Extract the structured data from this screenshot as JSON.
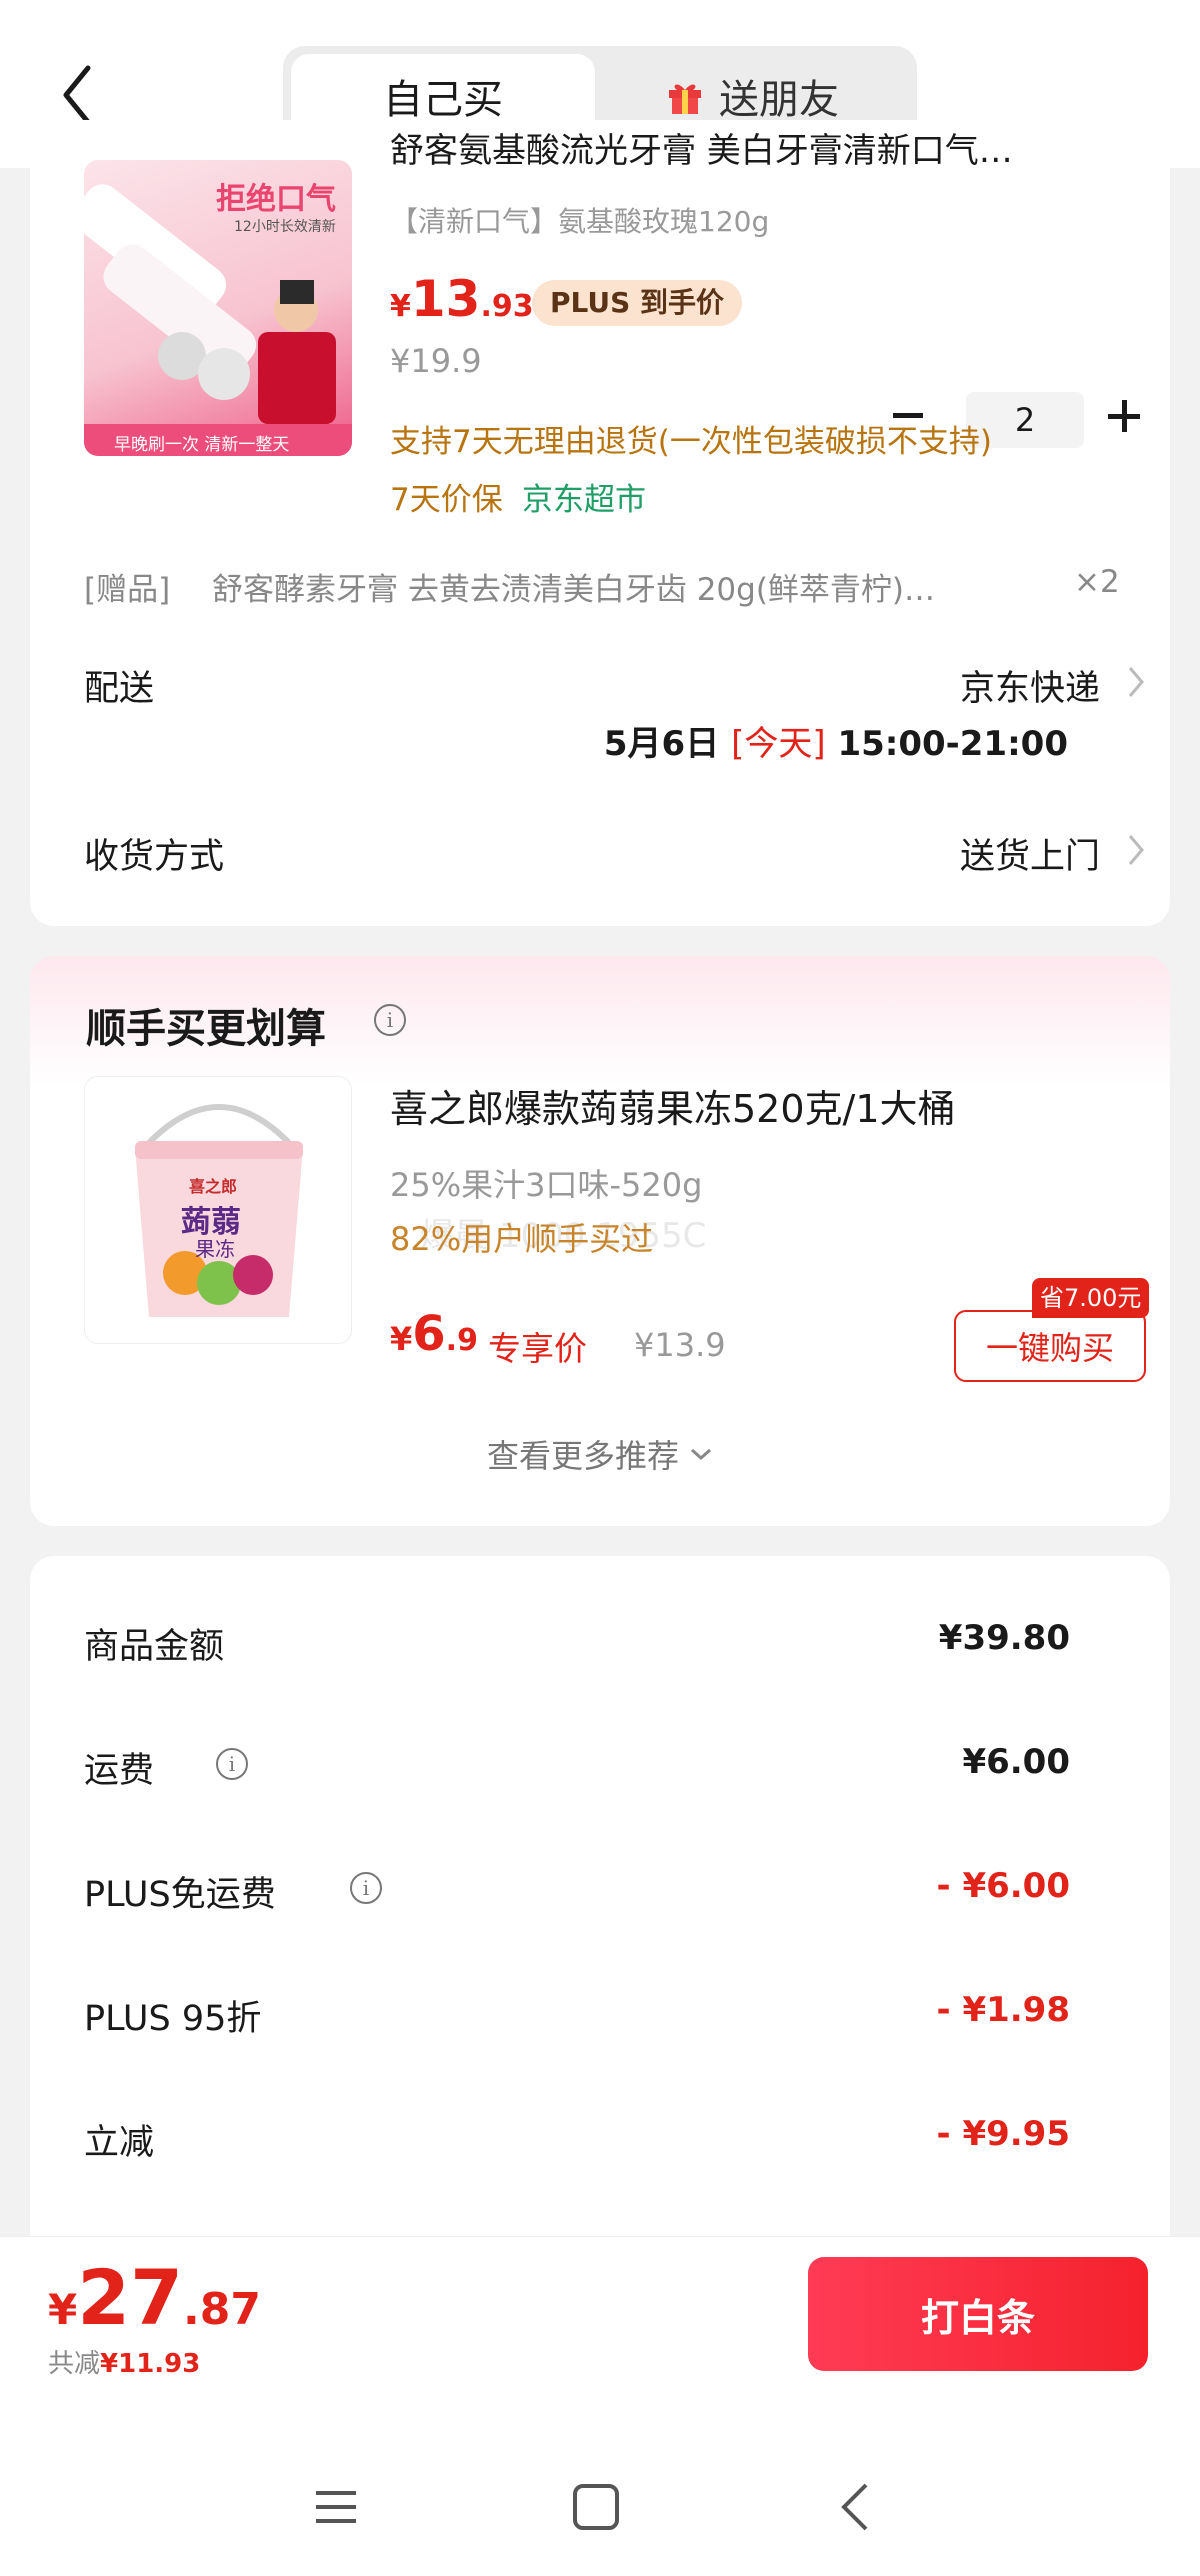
{
  "header": {
    "tabs": [
      {
        "label": "自己买",
        "active": true
      },
      {
        "label": "送朋友",
        "active": false
      }
    ]
  },
  "product": {
    "title": "舒客氨基酸流光牙膏 美白牙膏清新口气…",
    "spec": "【清新口气】氨基酸玫瑰120g",
    "price_symbol": "¥",
    "price_int": "13",
    "price_dec": ".93",
    "plus_tag": "PLUS 到手价",
    "original_price": "¥19.9",
    "quantity": "2",
    "return_policy": "支持7天无理由退货(一次性包装破损不支持)",
    "price_protect": "7天价保",
    "store": "京东超市",
    "thumb_text": {
      "headline": "拒绝口气",
      "sub": "12小时长效清新",
      "bottom": "早晚刷一次 清新一整天"
    }
  },
  "gift": {
    "tag": "[赠品]",
    "name": "舒客酵素牙膏 去黄去渍清美白牙齿 20g(鲜萃青柠)…",
    "count": "×2"
  },
  "delivery": {
    "label": "配送",
    "carrier": "京东快递",
    "date": "5月6日",
    "today": "[今天]",
    "time": "15:00-21:00"
  },
  "receive": {
    "label": "收货方式",
    "value": "送货上门"
  },
  "recommend": {
    "title": "顺手买更划算",
    "item_title": "喜之郎爆款蒟蒻果冻520克/1大桶",
    "item_spec": "25%果汁3口味-520g",
    "item_social": "82%用户顺手买过",
    "watermark": "爆晨 1000 1955C",
    "price_symbol": "¥",
    "price_int": "6",
    "price_dec": ".9",
    "exclusive": "专享价",
    "original_price": "¥13.9",
    "save_tag": "省7.00元",
    "buy_button": "一键购买",
    "more": "查看更多推荐",
    "thumb_text": {
      "brand": "喜之郎",
      "name1": "蒟蒻",
      "name2": "果冻"
    }
  },
  "summary": {
    "rows": [
      {
        "label": "商品金额",
        "value": "¥39.80"
      },
      {
        "label": "运费",
        "value": "¥6.00"
      },
      {
        "label": "PLUS免运费",
        "value": "- ¥6.00"
      },
      {
        "label": "PLUS 95折",
        "value": "- ¥1.98"
      },
      {
        "label": "立减",
        "value": "- ¥9.95"
      }
    ]
  },
  "footer": {
    "total_symbol": "¥",
    "total_int": "27",
    "total_dec": ".87",
    "saved_label": "共减",
    "saved_value": "¥11.93",
    "pay_button": "打白条"
  },
  "colors": {
    "accent_red": "#e2231a",
    "gold": "#b8740f",
    "green": "#1f9f66"
  }
}
